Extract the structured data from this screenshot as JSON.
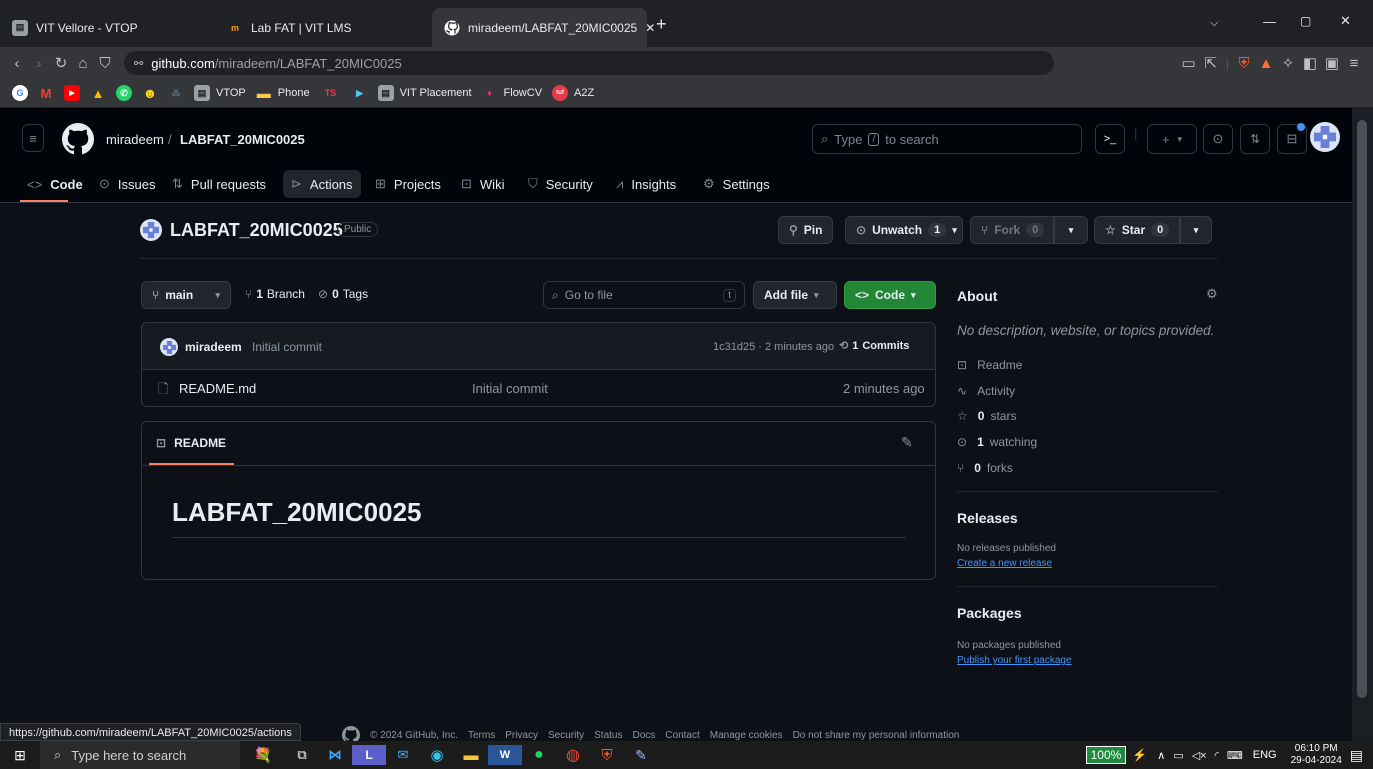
{
  "browser": {
    "tabs": [
      {
        "title": "VIT Vellore - VTOP"
      },
      {
        "title": "Lab FAT | VIT LMS"
      },
      {
        "title": "miradeem/LABFAT_20MIC0025"
      }
    ],
    "url_host": "github.com",
    "url_path": "/miradeem/LABFAT_20MIC0025",
    "bookmarks": [
      "VTOP",
      "Phone",
      "VIT Placement",
      "FlowCV",
      "A2Z"
    ],
    "status_url": "https://github.com/miradeem/LABFAT_20MIC0025/actions"
  },
  "header": {
    "owner": "miradeem",
    "separator": "/",
    "repo": "LABFAT_20MIC0025",
    "search_prefix": "Type",
    "search_key": "/",
    "search_suffix": "to search",
    "nav": [
      "Code",
      "Issues",
      "Pull requests",
      "Actions",
      "Projects",
      "Wiki",
      "Security",
      "Insights",
      "Settings"
    ]
  },
  "repo": {
    "name": "LABFAT_20MIC0025",
    "visibility": "Public",
    "pin": "Pin",
    "unwatch": "Unwatch",
    "unwatch_count": "1",
    "fork": "Fork",
    "fork_count": "0",
    "star": "Star",
    "star_count": "0"
  },
  "toolbar": {
    "branch": "main",
    "branch_count": "1",
    "branch_label": "Branch",
    "tag_count": "0",
    "tag_label": "Tags",
    "goto_placeholder": "Go to file",
    "goto_key": "t",
    "add_file": "Add file",
    "code": "Code"
  },
  "commit": {
    "author": "miradeem",
    "message": "Initial commit",
    "hash_time": "1c31d25 · 2 minutes ago",
    "commits_count": "1",
    "commits_label": "Commits"
  },
  "files": [
    {
      "name": "README.md",
      "message": "Initial commit",
      "time": "2 minutes ago"
    }
  ],
  "readme": {
    "tab": "README",
    "heading": "LABFAT_20MIC0025"
  },
  "about": {
    "title": "About",
    "description": "No description, website, or topics provided.",
    "readme": "Readme",
    "activity": "Activity",
    "stars_count": "0",
    "stars_label": "stars",
    "watching_count": "1",
    "watching_label": "watching",
    "forks_count": "0",
    "forks_label": "forks",
    "releases_title": "Releases",
    "releases_text": "No releases published",
    "releases_link": "Create a new release",
    "packages_title": "Packages",
    "packages_text": "No packages published",
    "packages_link": "Publish your first package"
  },
  "footer": {
    "copyright": "© 2024 GitHub, Inc.",
    "links": [
      "Terms",
      "Privacy",
      "Security",
      "Status",
      "Docs",
      "Contact",
      "Manage cookies",
      "Do not share my personal information"
    ]
  },
  "taskbar": {
    "search": "Type here to search",
    "battery": "100%",
    "lang": "ENG",
    "time": "06:10 PM",
    "date": "29-04-2024"
  },
  "colors": {
    "green": "#238636",
    "accent": "#f78166",
    "link": "#4493f8"
  }
}
